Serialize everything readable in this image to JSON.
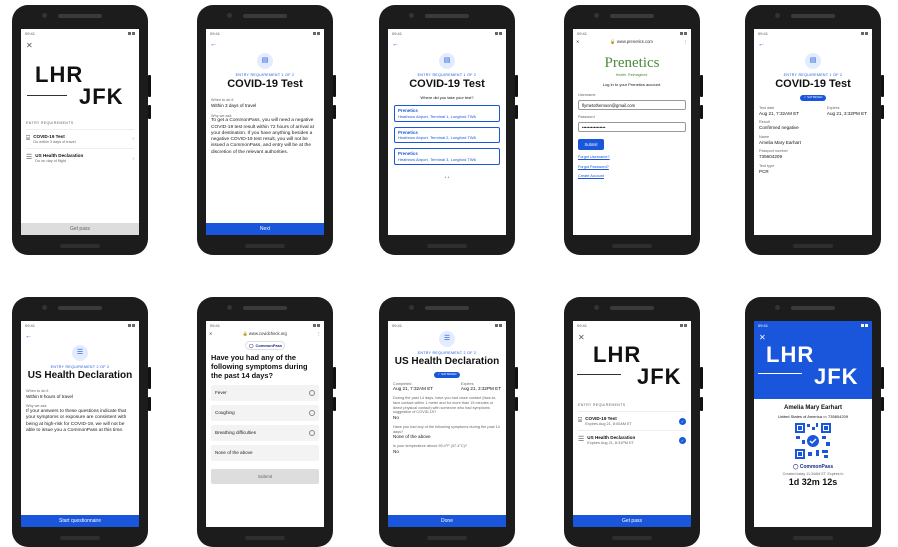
{
  "p1": {
    "time": "09:41",
    "from": "LHR",
    "to": "JFK",
    "section": "ENTRY REQUIREMENTS",
    "items": [
      {
        "title": "COVID-19 Test",
        "sub": "Do within 3 days of travel"
      },
      {
        "title": "US Health Declaration",
        "sub": "Do on day of flight"
      }
    ],
    "cta": "Get pass"
  },
  "p2": {
    "time": "09:41",
    "req": "ENTRY REQUIREMENT 1 OF 2",
    "title": "COVID-19 Test",
    "when_label": "When to do it",
    "when": "Within 3 days of travel",
    "why_label": "Why we ask",
    "why": "To get a CommonPass, you will need a negative COVID-19 test result within 72 hours of arrival at your destination. If you have anything besides a negative COVID-19 test result, you will not be issued a CommonPass, and entry will be at the discretion of the relevant authorities.",
    "cta": "Next"
  },
  "p3": {
    "time": "09:41",
    "req": "ENTRY REQUIREMENT 1 OF 2",
    "title": "COVID-19 Test",
    "question": "Where did you take your test?",
    "options": [
      {
        "name": "Prenetics",
        "addr": "Heathrow Airport, Terminal 1, Longford TW6"
      },
      {
        "name": "Prenetics",
        "addr": "Heathrow Airport, Terminal 2, Longford TW6"
      },
      {
        "name": "Prenetics",
        "addr": "Heathrow Airport, Terminal 3, Longford TW6"
      }
    ]
  },
  "p4": {
    "time": "09:41",
    "url": "www.prenetics.com",
    "brand": "Prenetics",
    "tagline": "Health. Reimagined.",
    "login": "Log in to your Prenetics account.",
    "user_label": "Username",
    "user": "flymetothemoon@gmail.com",
    "pass_label": "Password",
    "pass": "••••••••••••••••",
    "submit": "Submit",
    "forgot_user": "Forgot Username?",
    "forgot_pass": "Forgot Password?",
    "create": "Create Account"
  },
  "p5": {
    "time": "09:41",
    "req": "ENTRY REQUIREMENT 1 OF 2",
    "title": "COVID-19 Test",
    "badge": "SATISFIED",
    "test_date_label": "Test date",
    "test_date": "Aug 21, 7:32AM ET",
    "expires_label": "Expires",
    "expires": "Aug 21, 3:32PM ET",
    "result_label": "Result",
    "result": "Confirmed negative",
    "name_label": "Name",
    "name": "Amelia Mary Earhart",
    "passport_label": "Passport number",
    "passport": "735604209",
    "type_label": "Test type",
    "type": "PCR"
  },
  "p6": {
    "time": "09:41",
    "req": "ENTRY REQUIREMENT 2 OF 2",
    "title": "US Health Declaration",
    "when_label": "When to do it",
    "when": "Within 8 hours of travel",
    "why_label": "Why we ask",
    "why": "If your answers to these questions indicate that your symptoms or exposure are consistent with being at high-risk for COVID-19, we will not be able to issue you a CommonPass at this time.",
    "cta": "Start questionnaire"
  },
  "p7": {
    "time": "09:41",
    "url": "www.covidcheck.org",
    "brand": "CommonPass",
    "question": "Have you had any of the following symptoms during the past 14 days?",
    "answers": [
      "Fever",
      "Coughing",
      "Breathing difficulties",
      "None of the above"
    ],
    "submit": "Submit"
  },
  "p8": {
    "time": "09:41",
    "req": "ENTRY REQUIREMENT 2 OF 2",
    "title": "US Health Declaration",
    "badge": "SATISFIED",
    "completed_label": "Completed",
    "completed": "Aug 21, 7:32AM ET",
    "expires_label": "Expires",
    "expires": "Aug 21, 3:32PM ET",
    "q1": "During the past 14 days, have you had close contact (face-to-face contact within 1 meter and for more than 15 minutes or direct physical contact) with someone who had symptoms suggestive of COVID-19?",
    "a1": "No",
    "q2": "Have you had any of the following symptoms during the past 14 days?",
    "a2": "None of the above",
    "q3": "Is your temperature above 99.4°F (37.4°C)?",
    "a3": "No",
    "cta": "Done"
  },
  "p9": {
    "time": "09:41",
    "from": "LHR",
    "to": "JFK",
    "section": "ENTRY REQUIREMENTS",
    "items": [
      {
        "title": "COVID-19 Test",
        "sub": "Expires Aug 21, 8:00AM ET"
      },
      {
        "title": "US Health Declaration",
        "sub": "Expires Aug 21, 8:31PM ET"
      }
    ],
    "cta": "Get pass"
  },
  "p10": {
    "time": "09:41",
    "from": "LHR",
    "to": "JFK",
    "name": "Amelia Mary Earhart",
    "country": "United States of America",
    "passport": "735604209",
    "brand": "CommonPass",
    "created": "Created today 11:34AM ET. Expires in",
    "countdown": "1d 32m 12s"
  },
  "colors": {
    "accent": "#1a56db",
    "prenetics": "#4a8a3a"
  }
}
